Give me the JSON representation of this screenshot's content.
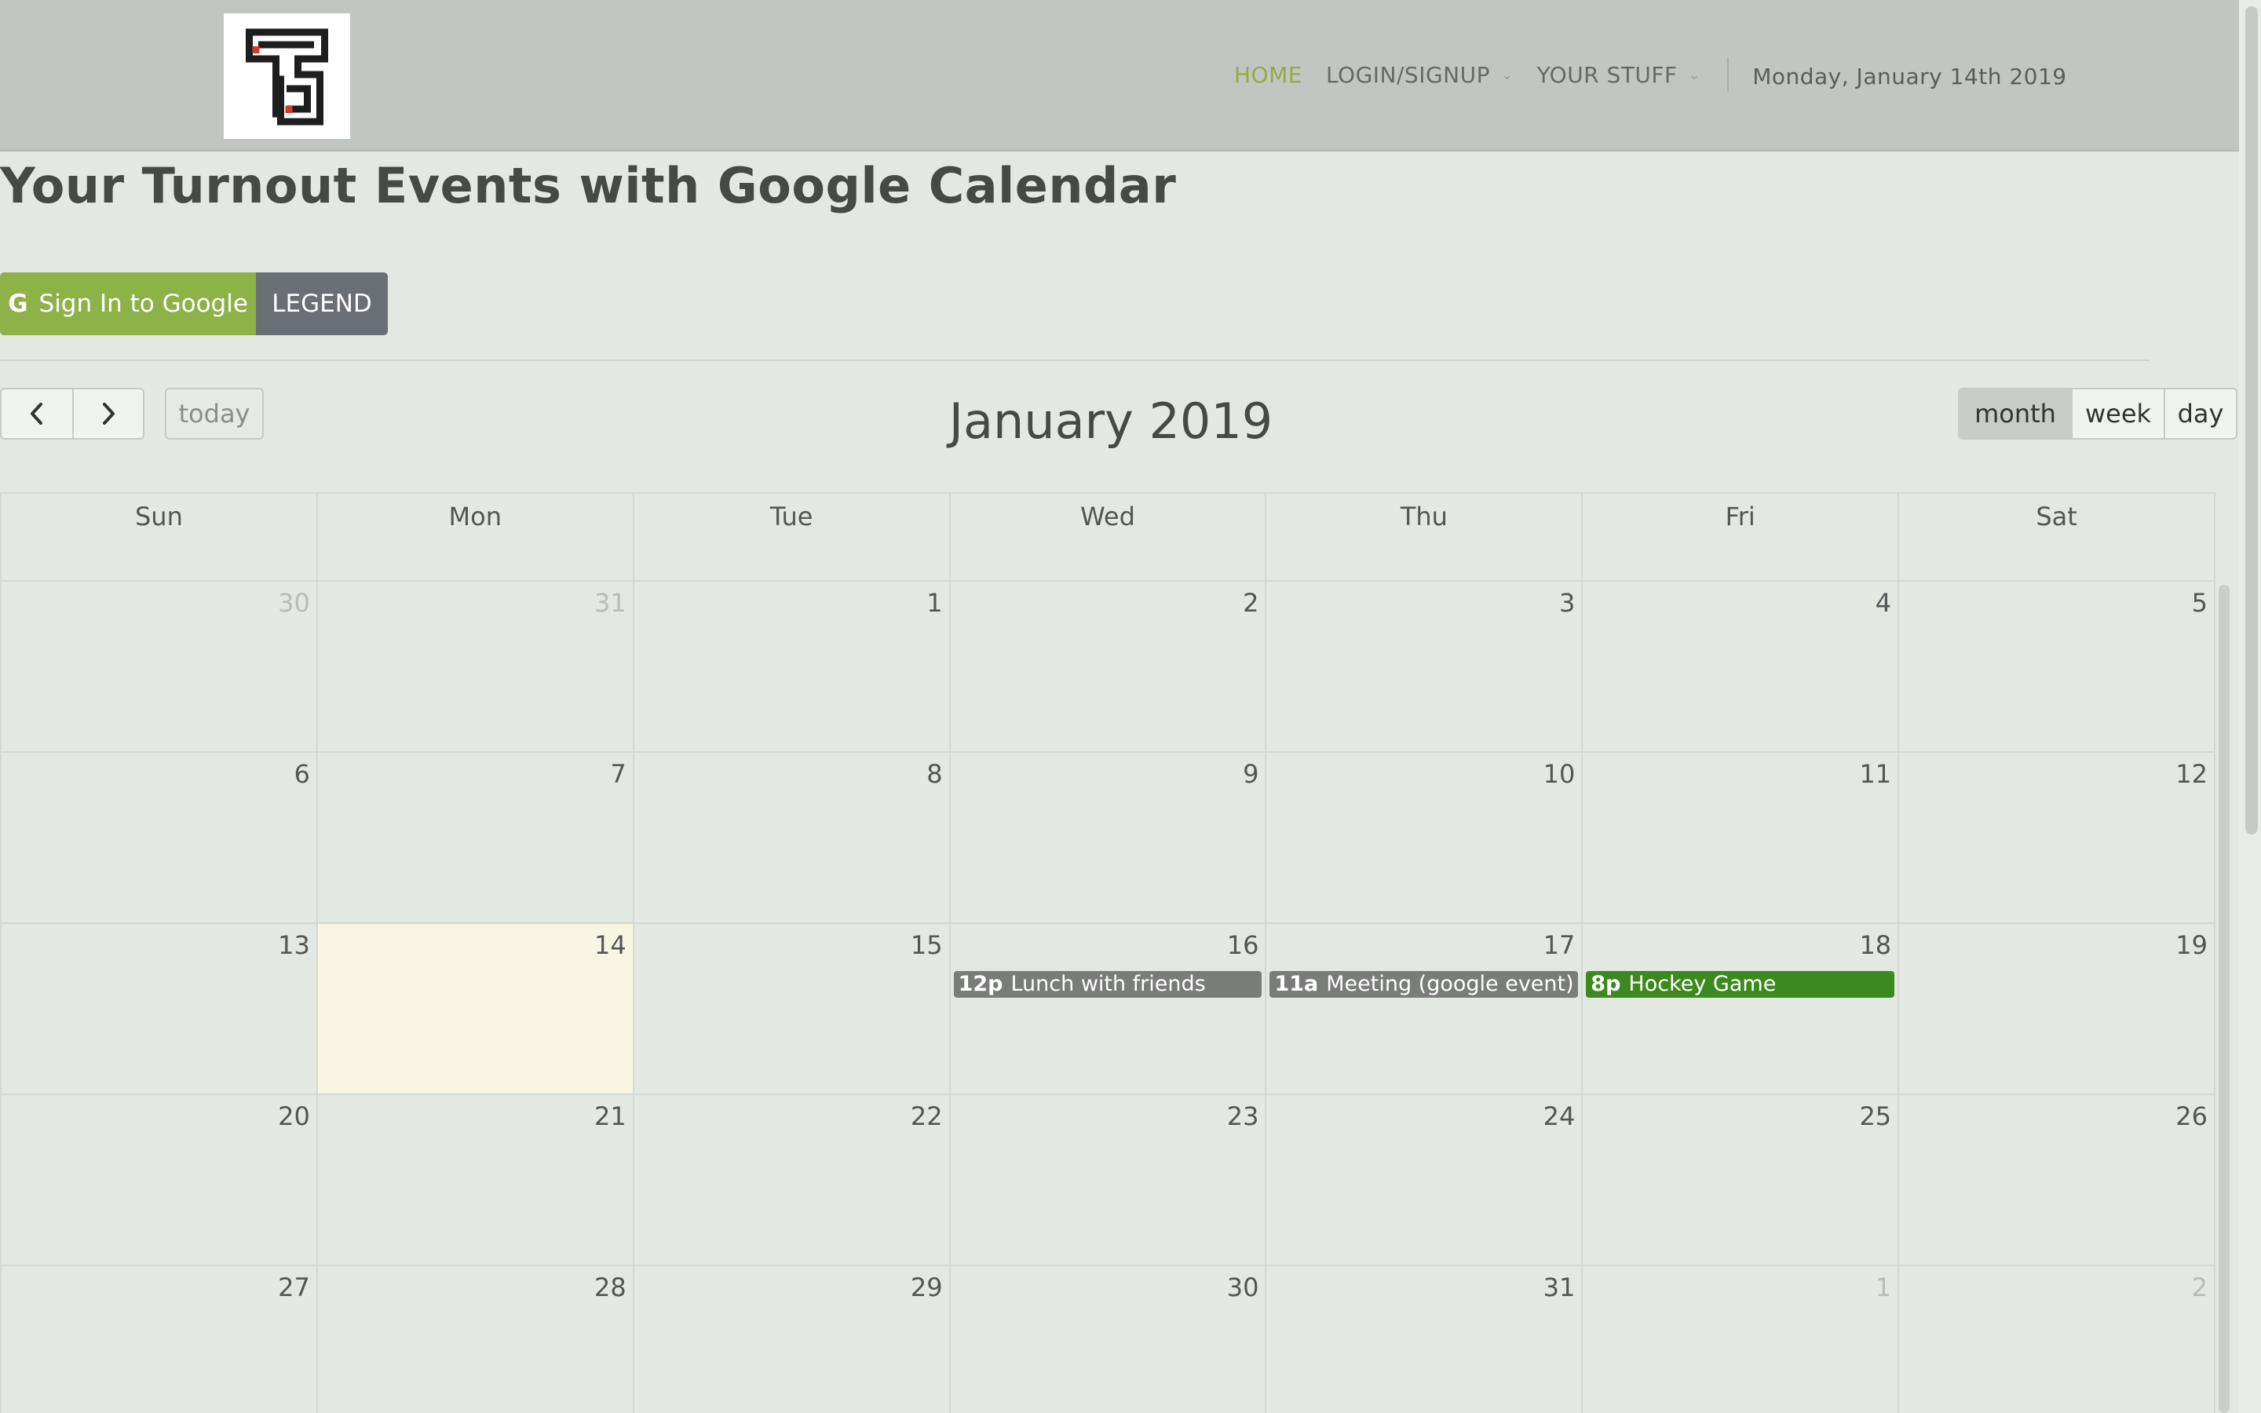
{
  "nav": {
    "home": "HOME",
    "login": "LOGIN/SIGNUP",
    "your_stuff": "YOUR STUFF",
    "date": "Monday, January 14th 2019"
  },
  "page_title": "Your Turnout Events with Google Calendar",
  "buttons": {
    "google_icon": "G",
    "google": "Sign In to Google",
    "legend": "LEGEND"
  },
  "toolbar": {
    "prev": "<",
    "next": ">",
    "today": "today",
    "title": "January 2019",
    "views": [
      "month",
      "week",
      "day"
    ],
    "active_view": "month"
  },
  "weekdays": [
    "Sun",
    "Mon",
    "Tue",
    "Wed",
    "Thu",
    "Fri",
    "Sat"
  ],
  "weeks": [
    [
      {
        "d": "30",
        "other": true
      },
      {
        "d": "31",
        "other": true
      },
      {
        "d": "1"
      },
      {
        "d": "2"
      },
      {
        "d": "3"
      },
      {
        "d": "4"
      },
      {
        "d": "5"
      }
    ],
    [
      {
        "d": "6"
      },
      {
        "d": "7"
      },
      {
        "d": "8"
      },
      {
        "d": "9"
      },
      {
        "d": "10"
      },
      {
        "d": "11"
      },
      {
        "d": "12"
      }
    ],
    [
      {
        "d": "13"
      },
      {
        "d": "14",
        "today": true
      },
      {
        "d": "15"
      },
      {
        "d": "16"
      },
      {
        "d": "17"
      },
      {
        "d": "18"
      },
      {
        "d": "19"
      }
    ],
    [
      {
        "d": "20"
      },
      {
        "d": "21"
      },
      {
        "d": "22"
      },
      {
        "d": "23"
      },
      {
        "d": "24"
      },
      {
        "d": "25"
      },
      {
        "d": "26"
      }
    ],
    [
      {
        "d": "27"
      },
      {
        "d": "28"
      },
      {
        "d": "29"
      },
      {
        "d": "30"
      },
      {
        "d": "31"
      },
      {
        "d": "1",
        "other": true
      },
      {
        "d": "2",
        "other": true
      }
    ]
  ],
  "events": [
    {
      "week": 2,
      "day": 3,
      "time": "12p",
      "title": "Lunch with friends",
      "color": "#7a7c7a"
    },
    {
      "week": 2,
      "day": 4,
      "time": "11a",
      "title": "Meeting (google event)",
      "color": "#7a7c7a"
    },
    {
      "week": 2,
      "day": 5,
      "time": "8p",
      "title": "Hockey Game",
      "color": "#3c8a1e"
    }
  ],
  "colors": {
    "accent_green": "#8db248",
    "legend_gray": "#6a6f75",
    "today_bg": "#f8f6e3"
  }
}
